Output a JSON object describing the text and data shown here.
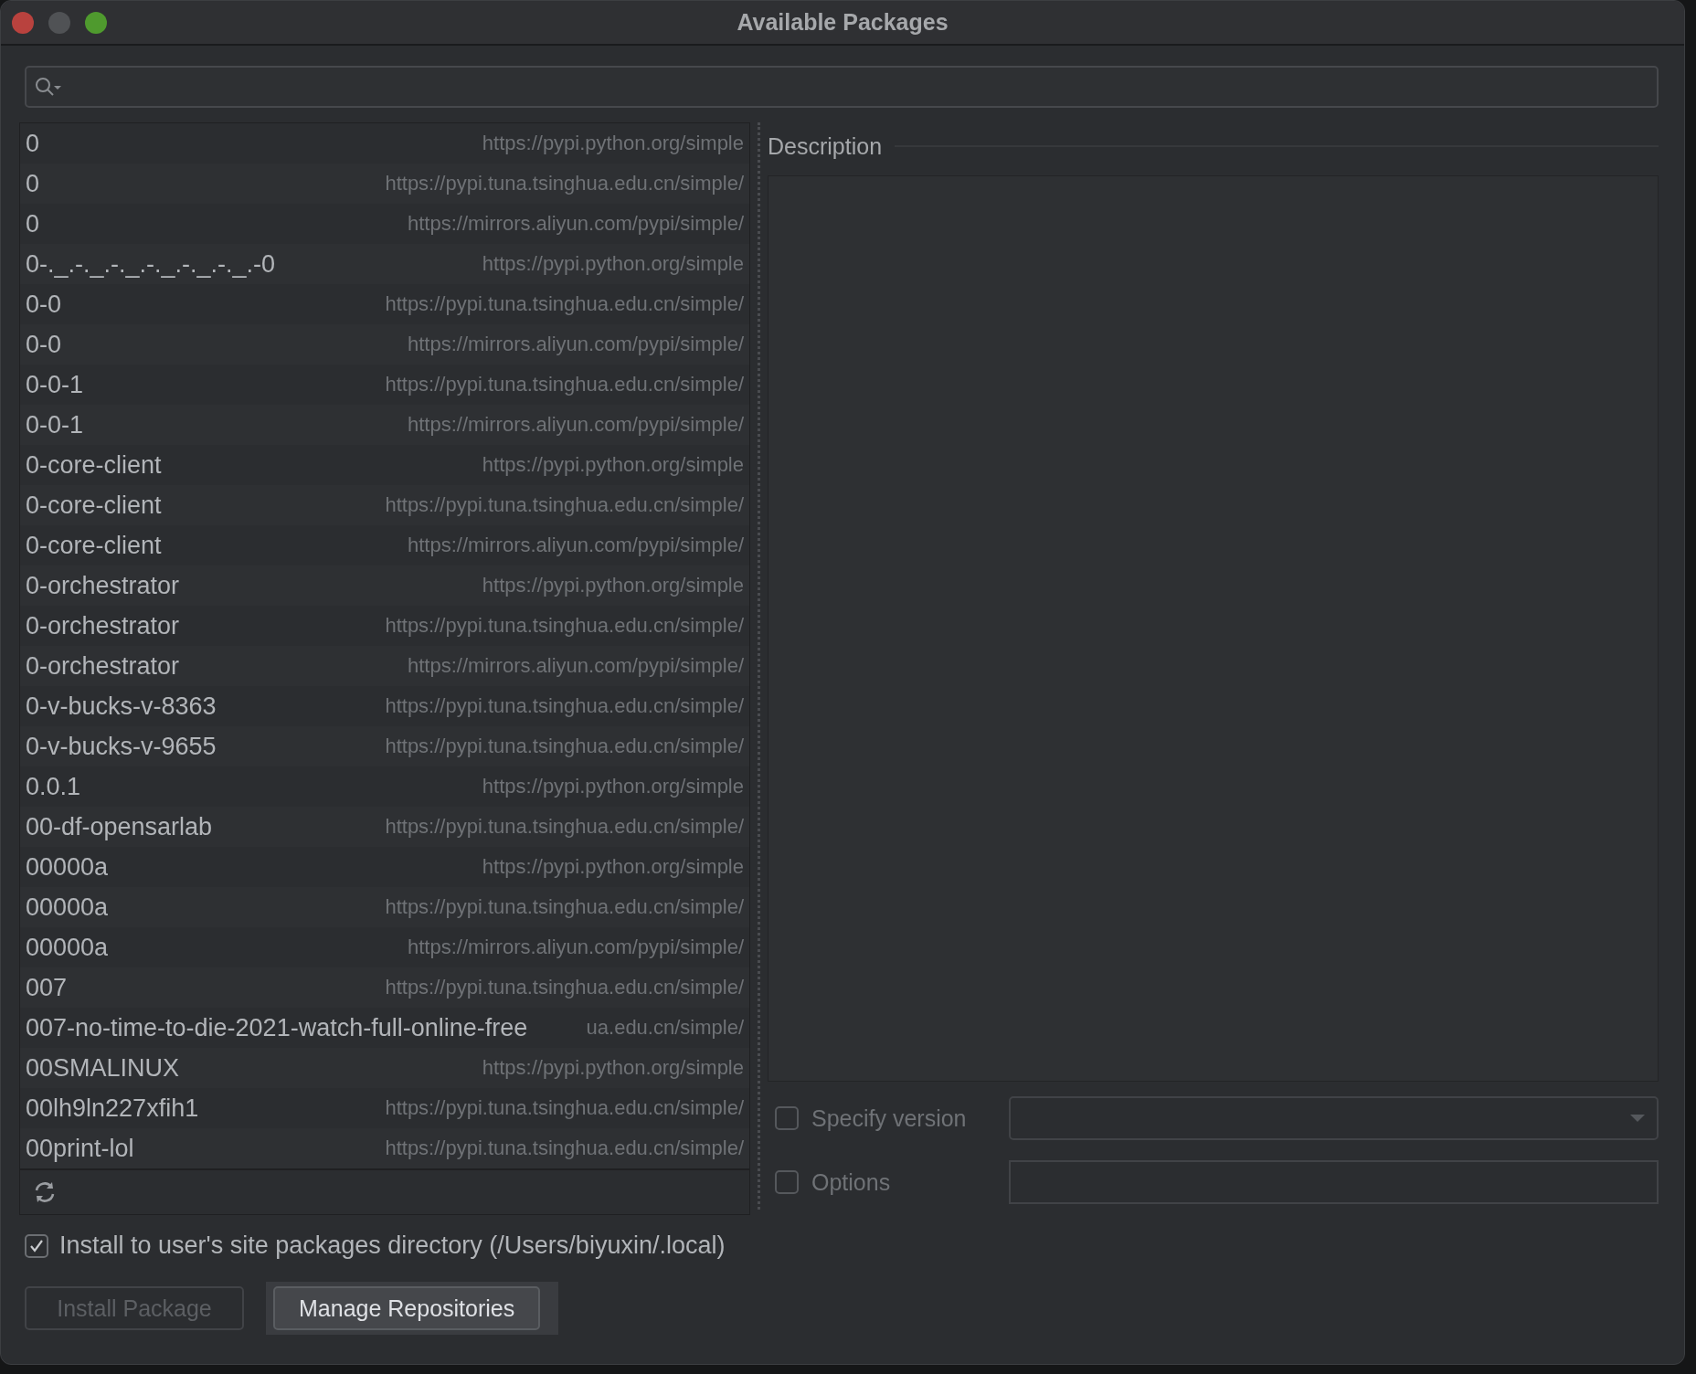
{
  "window": {
    "title": "Available Packages"
  },
  "packages": [
    {
      "name": "0",
      "repository": "https://pypi.python.org/simple"
    },
    {
      "name": "0",
      "repository": "https://pypi.tuna.tsinghua.edu.cn/simple/"
    },
    {
      "name": "0",
      "repository": "https://mirrors.aliyun.com/pypi/simple/"
    },
    {
      "name": "0-._.-._.-._.-._.-._.-._.-0",
      "repository": "https://pypi.python.org/simple"
    },
    {
      "name": "0-0",
      "repository": "https://pypi.tuna.tsinghua.edu.cn/simple/"
    },
    {
      "name": "0-0",
      "repository": "https://mirrors.aliyun.com/pypi/simple/"
    },
    {
      "name": "0-0-1",
      "repository": "https://pypi.tuna.tsinghua.edu.cn/simple/"
    },
    {
      "name": "0-0-1",
      "repository": "https://mirrors.aliyun.com/pypi/simple/"
    },
    {
      "name": "0-core-client",
      "repository": "https://pypi.python.org/simple"
    },
    {
      "name": "0-core-client",
      "repository": "https://pypi.tuna.tsinghua.edu.cn/simple/"
    },
    {
      "name": "0-core-client",
      "repository": "https://mirrors.aliyun.com/pypi/simple/"
    },
    {
      "name": "0-orchestrator",
      "repository": "https://pypi.python.org/simple"
    },
    {
      "name": "0-orchestrator",
      "repository": "https://pypi.tuna.tsinghua.edu.cn/simple/"
    },
    {
      "name": "0-orchestrator",
      "repository": "https://mirrors.aliyun.com/pypi/simple/"
    },
    {
      "name": "0-v-bucks-v-8363",
      "repository": "https://pypi.tuna.tsinghua.edu.cn/simple/"
    },
    {
      "name": "0-v-bucks-v-9655",
      "repository": "https://pypi.tuna.tsinghua.edu.cn/simple/"
    },
    {
      "name": "0.0.1",
      "repository": "https://pypi.python.org/simple"
    },
    {
      "name": "00-df-opensarlab",
      "repository": "https://pypi.tuna.tsinghua.edu.cn/simple/"
    },
    {
      "name": "00000a",
      "repository": "https://pypi.python.org/simple"
    },
    {
      "name": "00000a",
      "repository": "https://pypi.tuna.tsinghua.edu.cn/simple/"
    },
    {
      "name": "00000a",
      "repository": "https://mirrors.aliyun.com/pypi/simple/"
    },
    {
      "name": "007",
      "repository": "https://pypi.tuna.tsinghua.edu.cn/simple/"
    },
    {
      "name": "007-no-time-to-die-2021-watch-full-online-free",
      "repository": "ua.edu.cn/simple/"
    },
    {
      "name": "00SMALINUX",
      "repository": "https://pypi.python.org/simple"
    },
    {
      "name": "00lh9ln227xfih1",
      "repository": "https://pypi.tuna.tsinghua.edu.cn/simple/"
    },
    {
      "name": "00print-lol",
      "repository": "https://pypi.tuna.tsinghua.edu.cn/simple/"
    }
  ],
  "description": {
    "title": "Description"
  },
  "specify_version": {
    "label": "Specify version",
    "checked": false
  },
  "options": {
    "label": "Options",
    "checked": false
  },
  "install_to_user": {
    "label": "Install to user's site packages directory (/Users/biyuxin/.local)",
    "checked": true
  },
  "buttons": [
    {
      "label": "Install Package",
      "disabled": true
    },
    {
      "label": "Manage Repositories",
      "disabled": false
    }
  ]
}
